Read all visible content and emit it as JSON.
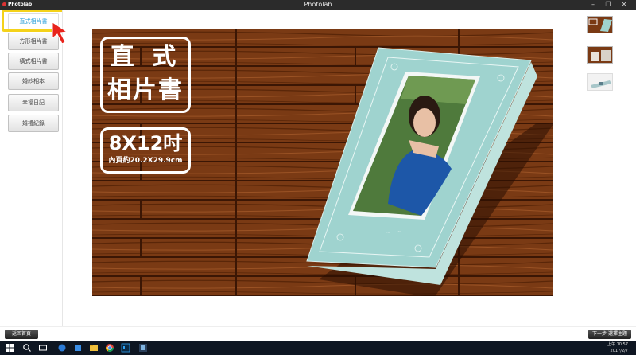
{
  "window": {
    "app_logo": "Photolab",
    "title": "Photolab",
    "minimize": "–",
    "maximize": "❐",
    "close": "✕"
  },
  "sidebar": {
    "items": [
      {
        "label": "直式相片書",
        "active": true
      },
      {
        "label": "方形相片書",
        "active": false
      },
      {
        "label": "橫式相片書",
        "active": false
      },
      {
        "label": "婚紗相本",
        "active": false
      },
      {
        "label": "幸福日記",
        "active": false
      },
      {
        "label": "婚禮紀錄",
        "active": false
      }
    ]
  },
  "preview": {
    "title_line1": "直 式",
    "title_line2": "相片書",
    "size_main": "8X12吋",
    "size_inner": "內頁約20.2X29.9cm"
  },
  "bottom": {
    "back_label": "返回首頁",
    "next_label": "下一步 選擇主題"
  },
  "tray": {
    "time": "上午 10:57",
    "date": "2017/2/7"
  },
  "colors": {
    "highlight": "#f4d21a",
    "active_text": "#2a9fd8",
    "cursor": "#e8231b",
    "book_cover": "#9fd3cf",
    "wood": "#7a3a14"
  }
}
